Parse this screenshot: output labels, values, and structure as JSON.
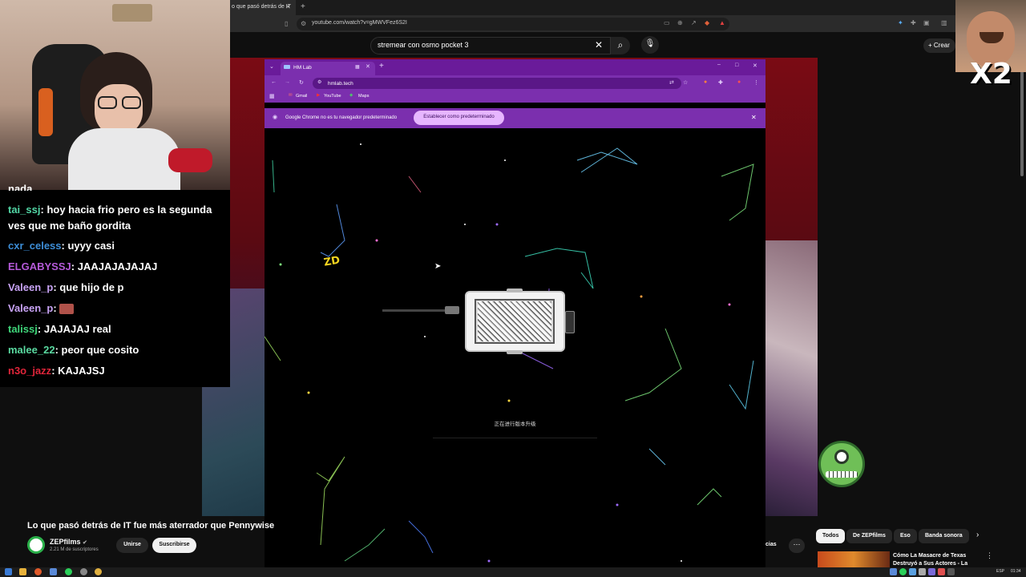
{
  "outer_browser": {
    "tab_title": "o que pasó detrás de IT",
    "url": "youtube.com/watch?v=gMWVFez6S2I"
  },
  "youtube": {
    "search_query": "stremear con osmo pocket 3",
    "create_label": "Crear",
    "video_title": "Lo que pasó detrás de IT fue más aterrador que Pennywise",
    "channel_name": "ZEPfilms",
    "subscribers": "2.21 M de suscriptores",
    "join_label": "Unirse",
    "subscribe_label": "Suscribirse",
    "actions_partial_label": "cias",
    "chips": [
      "Todos",
      "De ZEPfilms",
      "Eso",
      "Banda sonora"
    ],
    "recommendation_title": "Cómo La Masacre de Texas Destruyó a Sus Actores - La"
  },
  "inner_browser": {
    "tab_title": "HM Lab",
    "url": "hmlab.tech",
    "bookmarks": [
      "Gmail",
      "YouTube",
      "Maps"
    ],
    "infobar_text": "Google Chrome no es tu navegador predeterminado",
    "infobar_button": "Establecer como predeterminado",
    "logo_text": "ZD",
    "status_text": "正在进行版本升级"
  },
  "chat": [
    {
      "user": "tai_ssj",
      "color": "#52d6a5",
      "message": "hoy hacia frio pero es la segunda ves que me baño gordita"
    },
    {
      "user": "cxr_celess",
      "color": "#3d8ed8",
      "message": "uyyy casi"
    },
    {
      "user": "ELGABYSSJ",
      "color": "#b55ad9",
      "message": "JAAJAJAJAJAJ"
    },
    {
      "user": "Valeen_p",
      "color": "#c8a3f5",
      "message": "que hijo de p"
    },
    {
      "user": "Valeen_p",
      "color": "#c8a3f5",
      "message": ""
    },
    {
      "user": "talissj",
      "color": "#3fd67a",
      "message": "JAJAJAJ real"
    },
    {
      "user": "malee_22",
      "color": "#5ad9a0",
      "message": "peor que cosito"
    },
    {
      "user": "n3o_jazz",
      "color": "#e0253a",
      "message": "KAJAJSJ"
    }
  ],
  "chat_top_partial": "nada",
  "meme_text": "X2",
  "taskbar": {
    "lang": "ESP",
    "time": "01:34"
  },
  "colors": {
    "accent_purple": "#7b2fae",
    "youtube_bg": "#0f0f0f"
  }
}
